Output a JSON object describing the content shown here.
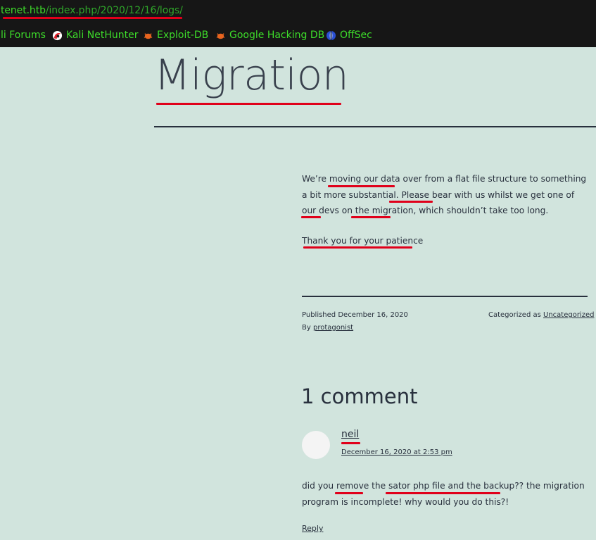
{
  "browser": {
    "url_host": "tenet.htb",
    "url_path": "/index.php/2020/12/16/logs/",
    "bookmarks": [
      {
        "label": "li Forums",
        "icon": "none"
      },
      {
        "label": "Kali NetHunter",
        "icon": "nethunter-icon"
      },
      {
        "label": "Exploit-DB",
        "icon": "exploit-db-icon"
      },
      {
        "label": "Google Hacking DB",
        "icon": "ghdb-icon"
      },
      {
        "label": "OffSec",
        "icon": "offsec-icon"
      }
    ],
    "colors": {
      "bar": "#161616",
      "text": "#3ddc2a",
      "annotation": "#e0001a"
    }
  },
  "post": {
    "title": "Migration",
    "p1": {
      "s1": "We’re ",
      "u1": "moving our data",
      "s2": " over from a flat file structure to something a bit more substantial. ",
      "u2": "Please bea",
      "s3": "r with us whilst we get one of our ",
      "u3": "devs",
      "s4": " on the ",
      "u4": "migration",
      "s5": ", which shouldn’t take too long."
    },
    "p2": "Thank you for your patience",
    "meta": {
      "published_label": "Published",
      "published_date": "December 16, 2020",
      "by_label": "By",
      "author": "protagonist",
      "category_label": "Categorized as",
      "category": "Uncategorized"
    },
    "background": "#d1e4dd"
  },
  "comments": {
    "title": "1 comment",
    "items": [
      {
        "author": "neil",
        "date": "December 16, 2020 at 2:53 pm",
        "text": {
          "s1": "did you ",
          "u1": "remove",
          "s2": " the sa",
          "u2": "tor php file and the backup",
          "s3": "?? the migration program is incomplete! why would you do this?!"
        },
        "reply_label": "Reply"
      }
    ]
  }
}
